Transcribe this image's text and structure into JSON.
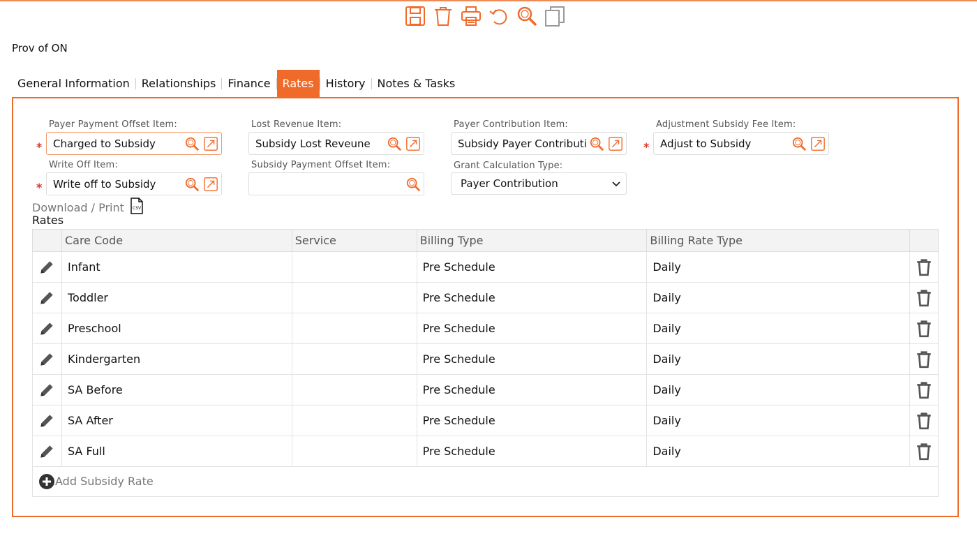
{
  "org_name": "Prov of ON",
  "toolbar": {
    "icons": [
      "save-icon",
      "delete-icon",
      "print-icon",
      "undo-icon",
      "search-icon",
      "copy-icon"
    ],
    "accent": "#f06a2a"
  },
  "tabs": [
    {
      "label": "General Information",
      "active": false
    },
    {
      "label": "Relationships",
      "active": false
    },
    {
      "label": "Finance",
      "active": false
    },
    {
      "label": "Rates",
      "active": true
    },
    {
      "label": "History",
      "active": false
    },
    {
      "label": "Notes & Tasks",
      "active": false
    }
  ],
  "fields": {
    "payer_payment_offset": {
      "label": "Payer Payment Offset Item:",
      "value": "Charged to Subsidy",
      "required": true
    },
    "lost_revenue": {
      "label": "Lost Revenue Item:",
      "value": "Subsidy Lost Reveune",
      "required": false
    },
    "payer_contribution": {
      "label": "Payer Contribution Item:",
      "value": "Subsidy Payer Contributi",
      "required": false
    },
    "adjustment_subsidy_fee": {
      "label": "Adjustment Subsidy Fee Item:",
      "value": "Adjust to Subsidy",
      "required": true
    },
    "write_off": {
      "label": "Write Off Item:",
      "value": "Write off to Subsidy",
      "required": true
    },
    "subsidy_payment_offset": {
      "label": "Subsidy Payment Offset Item:",
      "value": "",
      "required": false
    },
    "grant_calculation_type": {
      "label": "Grant Calculation Type:",
      "value": "Payer Contribution"
    }
  },
  "download": {
    "label": "Download / Print",
    "icon": "csv-file-icon"
  },
  "rates": {
    "title": "Rates",
    "columns": [
      "Care Code",
      "Service",
      "Billing Type",
      "Billing Rate Type"
    ],
    "rows": [
      {
        "care_code": "Infant",
        "service": "",
        "billing_type": "Pre Schedule",
        "billing_rate_type": "Daily"
      },
      {
        "care_code": "Toddler",
        "service": "",
        "billing_type": "Pre Schedule",
        "billing_rate_type": "Daily"
      },
      {
        "care_code": "Preschool",
        "service": "",
        "billing_type": "Pre Schedule",
        "billing_rate_type": "Daily"
      },
      {
        "care_code": "Kindergarten",
        "service": "",
        "billing_type": "Pre Schedule",
        "billing_rate_type": "Daily"
      },
      {
        "care_code": "SA Before",
        "service": "",
        "billing_type": "Pre Schedule",
        "billing_rate_type": "Daily"
      },
      {
        "care_code": "SA After",
        "service": "",
        "billing_type": "Pre Schedule",
        "billing_rate_type": "Daily"
      },
      {
        "care_code": "SA Full",
        "service": "",
        "billing_type": "Pre Schedule",
        "billing_rate_type": "Daily"
      }
    ],
    "add_label": "Add Subsidy Rate"
  }
}
